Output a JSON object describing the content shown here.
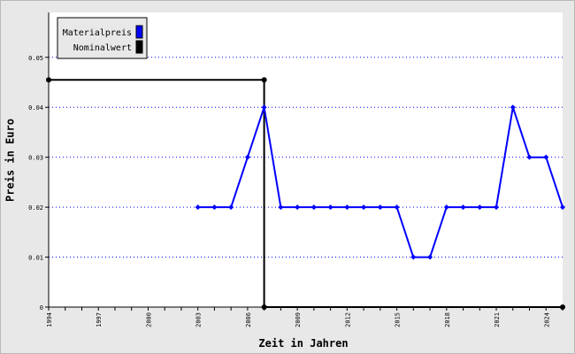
{
  "chart_data": {
    "type": "line",
    "xlabel": "Zeit in Jahren",
    "ylabel": "Preis in Euro",
    "xlim": [
      1994,
      2025
    ],
    "ylim": [
      0,
      0.059
    ],
    "yticks": [
      "0",
      "0.01",
      "0.02",
      "0.03",
      "0.04",
      "0.05"
    ],
    "xticks": [
      "1994",
      "1997",
      "2000",
      "2003",
      "2006",
      "2009",
      "2012",
      "2015",
      "2018",
      "2021",
      "2024"
    ],
    "grid": "horizontal dotted",
    "legend": {
      "placement": "top-left",
      "entries": [
        "Materialpreis",
        "Nominalwert"
      ]
    },
    "series": [
      {
        "name": "Materialpreis",
        "color": "#0000ff",
        "x": [
          2003,
          2004,
          2005,
          2006,
          2007,
          2008,
          2009,
          2010,
          2011,
          2012,
          2013,
          2014,
          2015,
          2016,
          2017,
          2018,
          2019,
          2020,
          2021,
          2022,
          2023,
          2024,
          2025
        ],
        "y": [
          0.02,
          0.02,
          0.02,
          0.03,
          0.04,
          0.02,
          0.02,
          0.02,
          0.02,
          0.02,
          0.02,
          0.02,
          0.02,
          0.01,
          0.01,
          0.02,
          0.02,
          0.02,
          0.02,
          0.04,
          0.03,
          0.03,
          0.02
        ]
      },
      {
        "name": "Nominalwert",
        "color": "#000000",
        "x": [
          1994,
          2007,
          2007,
          2025
        ],
        "y": [
          0.0455,
          0.0455,
          0,
          0
        ]
      }
    ]
  }
}
